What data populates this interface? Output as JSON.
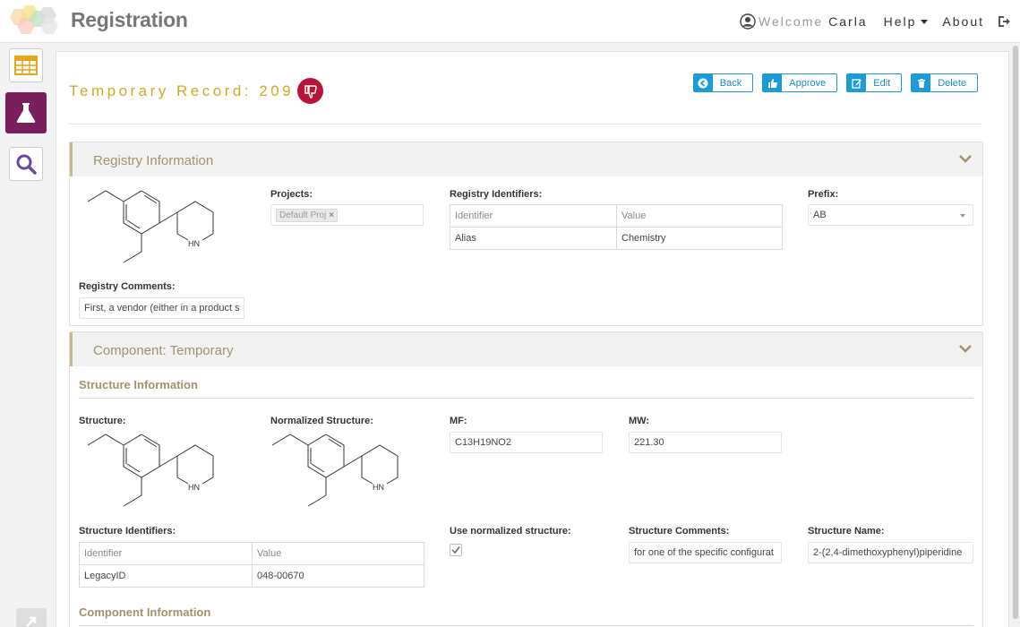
{
  "header": {
    "app_title": "Registration",
    "welcome_label": "Welcome",
    "username": "Carla",
    "help_label": "Help",
    "about_label": "About"
  },
  "sidebar": {
    "items": [
      {
        "name": "records-grid",
        "icon": "table-grid-icon",
        "active": false
      },
      {
        "name": "register",
        "icon": "flask-icon",
        "active": true
      },
      {
        "name": "search",
        "icon": "search-icon",
        "active": false
      }
    ]
  },
  "record": {
    "title": "Temporary Record: 209",
    "status_icon": "thumbs-down-icon",
    "actions": [
      {
        "label": "Back",
        "icon": "arrow-left-circle-icon"
      },
      {
        "label": "Approve",
        "icon": "thumbs-up-icon"
      },
      {
        "label": "Edit",
        "icon": "edit-icon"
      },
      {
        "label": "Delete",
        "icon": "trash-icon"
      }
    ]
  },
  "registry_panel": {
    "title": "Registry Information",
    "projects_label": "Projects:",
    "project_tag": "Default Proj",
    "identifiers_label": "Registry Identifiers:",
    "identifiers_table": {
      "headers": [
        "Identifier",
        "Value"
      ],
      "rows": [
        [
          "Alias",
          "Chemistry"
        ]
      ]
    },
    "prefix_label": "Prefix:",
    "prefix_value": "AB",
    "comments_label": "Registry Comments:",
    "comments_value": "First, a vendor (either in a product s"
  },
  "component_panel": {
    "title": "Component: Temporary",
    "structure_section_title": "Structure Information",
    "structure_label": "Structure:",
    "normalized_label": "Normalized Structure:",
    "mf_label": "MF:",
    "mf_value": "C13H19NO2",
    "mw_label": "MW:",
    "mw_value": "221.30",
    "structure_identifiers_label": "Structure Identifiers:",
    "structure_identifiers_table": {
      "headers": [
        "Identifier",
        "Value"
      ],
      "rows": [
        [
          "LegacyID",
          "048-00670"
        ]
      ]
    },
    "use_normalized_label": "Use normalized structure:",
    "use_normalized_checked": true,
    "structure_comments_label": "Structure Comments:",
    "structure_comments_value": "for one of the specific configurat",
    "structure_name_label": "Structure Name:",
    "structure_name_value": "2-(2,4-dimethoxyphenyl)piperidine",
    "component_section_title": "Component Information"
  },
  "molecule_label": "HN",
  "colors": {
    "accent_gold": "#d4a91f",
    "panel_title": "#a0926c",
    "button_blue": "#1b9bd7",
    "active_sidebar": "#7a1f5e",
    "status_red": "#b8143a"
  }
}
